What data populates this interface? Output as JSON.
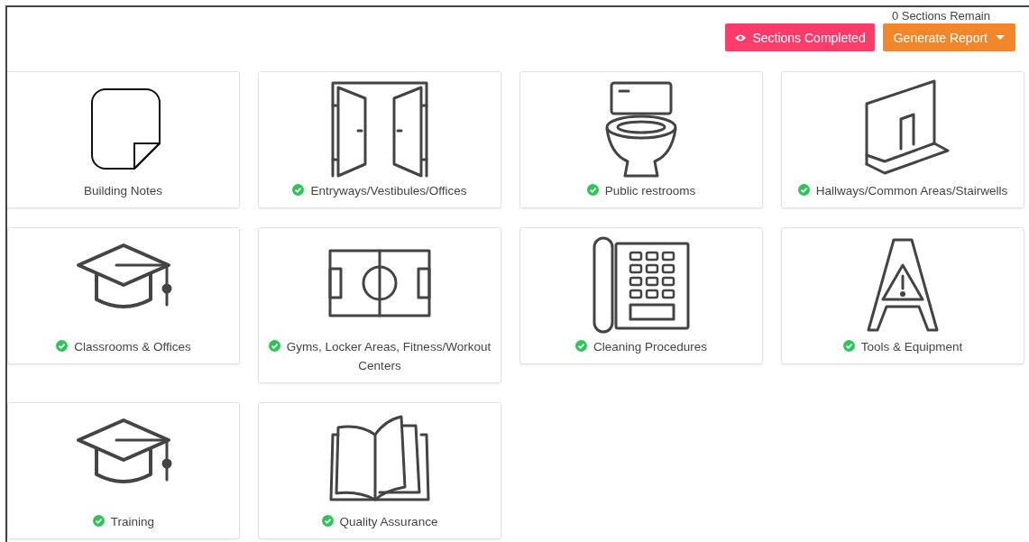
{
  "header": {
    "remaining": "0 Sections Remain",
    "buttons": [
      {
        "label": "Sections Completed",
        "kind": "completed"
      },
      {
        "label": "Generate Report",
        "kind": "report"
      }
    ]
  },
  "sections": [
    {
      "label": "Building Notes",
      "kind": "note",
      "completed": false
    },
    {
      "label": "Entryways/Vestibules/Offices",
      "kind": "doors",
      "completed": true
    },
    {
      "label": "Public restrooms",
      "kind": "toilet",
      "completed": true
    },
    {
      "label": "Hallways/Common Areas/Stairwells",
      "kind": "hallway",
      "completed": true
    },
    {
      "label": "Classrooms & Offices",
      "kind": "cap",
      "completed": true
    },
    {
      "label": "Gyms, Locker Areas, Fitness/Workout Centers",
      "kind": "field",
      "completed": true
    },
    {
      "label": "Cleaning Procedures",
      "kind": "phone",
      "completed": true
    },
    {
      "label": "Tools & Equipment",
      "kind": "sign",
      "completed": true
    },
    {
      "label": "Training",
      "kind": "cap",
      "completed": true
    },
    {
      "label": "Quality Assurance",
      "kind": "book",
      "completed": true
    }
  ]
}
